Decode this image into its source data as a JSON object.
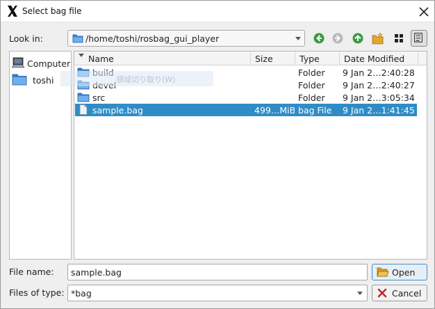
{
  "window": {
    "title": "Select bag file"
  },
  "lookin": {
    "label": "Look in:",
    "path": "/home/toshi/rosbag_gui_player"
  },
  "toolbar": {
    "icons": [
      "back-arrow-icon",
      "forward-arrow-icon",
      "parent-dir-icon",
      "new-folder-icon",
      "list-view-icon",
      "detail-view-icon"
    ]
  },
  "sidebar": {
    "items": [
      {
        "label": "Computer",
        "icon": "computer-icon"
      },
      {
        "label": "toshi",
        "icon": "folder-icon"
      }
    ]
  },
  "filelist": {
    "columns": [
      "Name",
      "Size",
      "Type",
      "Date Modified"
    ],
    "rows": [
      {
        "name": "build",
        "size": "",
        "type": "Folder",
        "date": "9 Jan 2…2:40:28",
        "icon": "folder-icon"
      },
      {
        "name": "devel",
        "size": "",
        "type": "Folder",
        "date": "9 Jan 2…2:40:27",
        "icon": "folder-icon"
      },
      {
        "name": "src",
        "size": "",
        "type": "Folder",
        "date": "9 Jan 2…3:05:34",
        "icon": "folder-icon"
      },
      {
        "name": "sample.bag",
        "size": "499…MiB",
        "type": "bag File",
        "date": "9 Jan 2…1:41:45",
        "icon": "file-icon",
        "selected": true
      }
    ]
  },
  "ghost_text": "領域切り取り(W)",
  "filename": {
    "label": "File name:",
    "value": "sample.bag"
  },
  "filetype": {
    "label": "Files of type:",
    "value": "*bag"
  },
  "buttons": {
    "open": "Open",
    "cancel": "Cancel"
  },
  "colors": {
    "selection": "#308cc6",
    "folder": "#2f7fd1",
    "nav_green": "#3b9a3b"
  }
}
